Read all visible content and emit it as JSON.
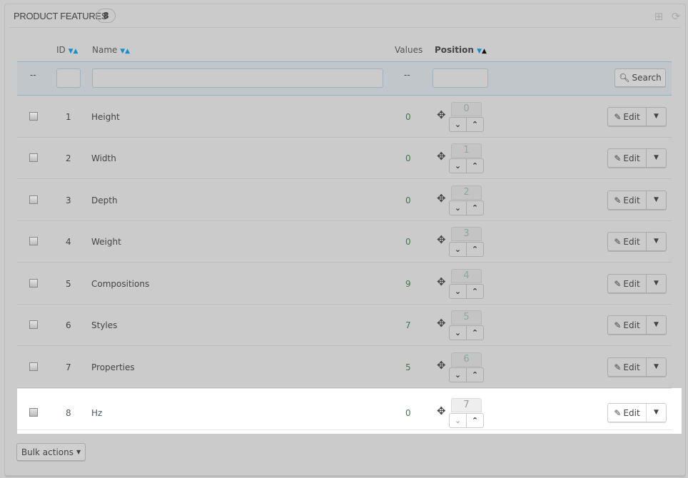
{
  "panel": {
    "title": "PRODUCT FEATURES",
    "count": "8",
    "icons": [
      "add-icon",
      "refresh-icon"
    ]
  },
  "headers": {
    "id": "ID",
    "name": "Name",
    "values": "Values",
    "position": "Position",
    "sort_down": "▼",
    "sort_up": "▲"
  },
  "filter": {
    "dash_check": "--",
    "id_value": "",
    "name_value": "",
    "dash_values": "--",
    "position_value": "",
    "search_label": "Search"
  },
  "rows": [
    {
      "id": "1",
      "name": "Height",
      "values": "0",
      "position": "0"
    },
    {
      "id": "2",
      "name": "Width",
      "values": "0",
      "position": "1"
    },
    {
      "id": "3",
      "name": "Depth",
      "values": "0",
      "position": "2"
    },
    {
      "id": "4",
      "name": "Weight",
      "values": "0",
      "position": "3"
    },
    {
      "id": "5",
      "name": "Compositions",
      "values": "9",
      "position": "4"
    },
    {
      "id": "6",
      "name": "Styles",
      "values": "7",
      "position": "5"
    },
    {
      "id": "7",
      "name": "Properties",
      "values": "5",
      "position": "6"
    },
    {
      "id": "8",
      "name": "Hz",
      "values": "0",
      "position": "7"
    }
  ],
  "row_action": {
    "edit_label": "Edit"
  },
  "bulk_actions": "Bulk actions"
}
